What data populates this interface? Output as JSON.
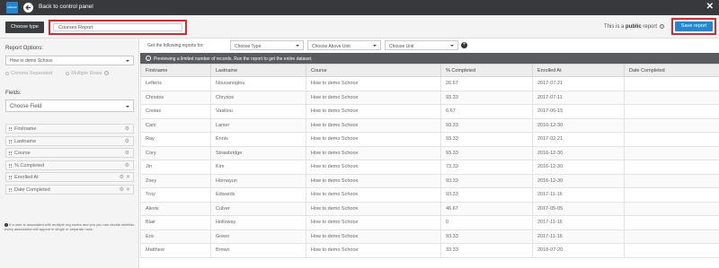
{
  "topbar": {
    "logo_text": "schoox",
    "back_label": "Back to control panel",
    "close_symbol": "✕"
  },
  "subheader": {
    "choose_type_label": "Choose type",
    "report_name_value": "Courses Report",
    "public_prefix": "This is a",
    "public_word": "public",
    "public_suffix": "report",
    "save_label": "Save report"
  },
  "left": {
    "report_options_label": "Report Options:",
    "report_option_selected": "How to demo Schoox",
    "radio_comma": "Comma Separated",
    "radio_multiple": "Multiple Rows",
    "fields_label": "Fields:",
    "choose_field": "Choose Field",
    "fields": [
      {
        "name": "Firstname",
        "removable": false
      },
      {
        "name": "Lastname",
        "removable": false
      },
      {
        "name": "Course",
        "removable": false
      },
      {
        "name": "% Completed",
        "removable": false
      },
      {
        "name": "Enrolled At",
        "removable": true
      },
      {
        "name": "Date Completed",
        "removable": true
      }
    ],
    "note": "If a user is associated with multiple org nodes and you you can decide whether every association will appear in single or separate rows."
  },
  "filters": {
    "label": "Get the following reports for:",
    "dropdowns": [
      "Choose Type",
      "Choose Above Unit",
      "Choose Unit"
    ]
  },
  "notice": "Previewing a limited number of records. Run the report to get the entire dataset.",
  "table": {
    "columns": [
      "Firstname",
      "Lastname",
      "Course",
      "% Completed",
      "Enrolled At",
      "Date Completed"
    ],
    "rows": [
      [
        "Lefteris",
        "Nouvanoglou",
        "How to demo Schoox",
        "26.67",
        "2017-07-21",
        ""
      ],
      [
        "Christos",
        "Chrysos",
        "How to demo Schoox",
        "93.33",
        "2017-07-11",
        ""
      ],
      [
        "Costas",
        "Vasiliou",
        "How to demo Schoox",
        "6.67",
        "2017-06-15",
        ""
      ],
      [
        "Cam",
        "Lanier",
        "How to demo Schoox",
        "93.33",
        "2016-12-30",
        ""
      ],
      [
        "Ray",
        "Ennis",
        "How to demo Schoox",
        "93.33",
        "2017-02-21",
        ""
      ],
      [
        "Cory",
        "Strawbridge",
        "How to demo Schoox",
        "93.33",
        "2016-12-30",
        ""
      ],
      [
        "Jin",
        "Kim",
        "How to demo Schoox",
        "73.33",
        "2016-12-30",
        ""
      ],
      [
        "Zoey",
        "Hornayun",
        "How to demo Schoox",
        "93.33",
        "2016-12-30",
        ""
      ],
      [
        "Troy",
        "Edwards",
        "How to demo Schoox",
        "93.33",
        "2017-11-16",
        ""
      ],
      [
        "Alexis",
        "Culver",
        "How to demo Schoox",
        "46.67",
        "2017-05-05",
        ""
      ],
      [
        "Blair",
        "Holloway",
        "How to demo Schoox",
        "0",
        "2017-11-16",
        ""
      ],
      [
        "Eric",
        "Green",
        "How to demo Schoox",
        "93.33",
        "2017-11-16",
        ""
      ],
      [
        "Matthew",
        "Brown",
        "How to demo Schoox",
        "33.33",
        "2018-07-20",
        ""
      ]
    ]
  },
  "colors": {
    "topbar": "#37393d",
    "accent_blue": "#1e88d6",
    "highlight_red": "#e2262b",
    "notice_bg": "#5a5b5f"
  }
}
